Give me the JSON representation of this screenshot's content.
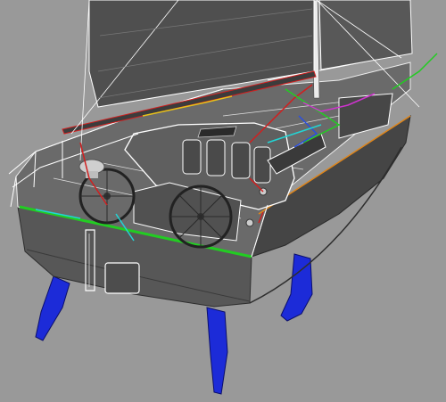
{
  "viewport": {
    "background": "#999999",
    "hull_color": "#4a4a4a",
    "hull_side_color": "#5a5a5a",
    "deck_color": "#6a6a6a",
    "sail_color": "#4f4f4f",
    "wire_color": "#ffffff",
    "appendage_color": "#1c2bd8",
    "rig_lines": {
      "red": "#d11f1f",
      "green": "#22cc22",
      "cyan": "#22d4d4",
      "yellow": "#e6c21a",
      "magenta": "#d033d0",
      "blue": "#2b4fe0",
      "orange": "#e0861a"
    },
    "icons": [
      "winch-icon",
      "helm-wheel-icon",
      "radome-icon",
      "hatch-icon"
    ]
  }
}
